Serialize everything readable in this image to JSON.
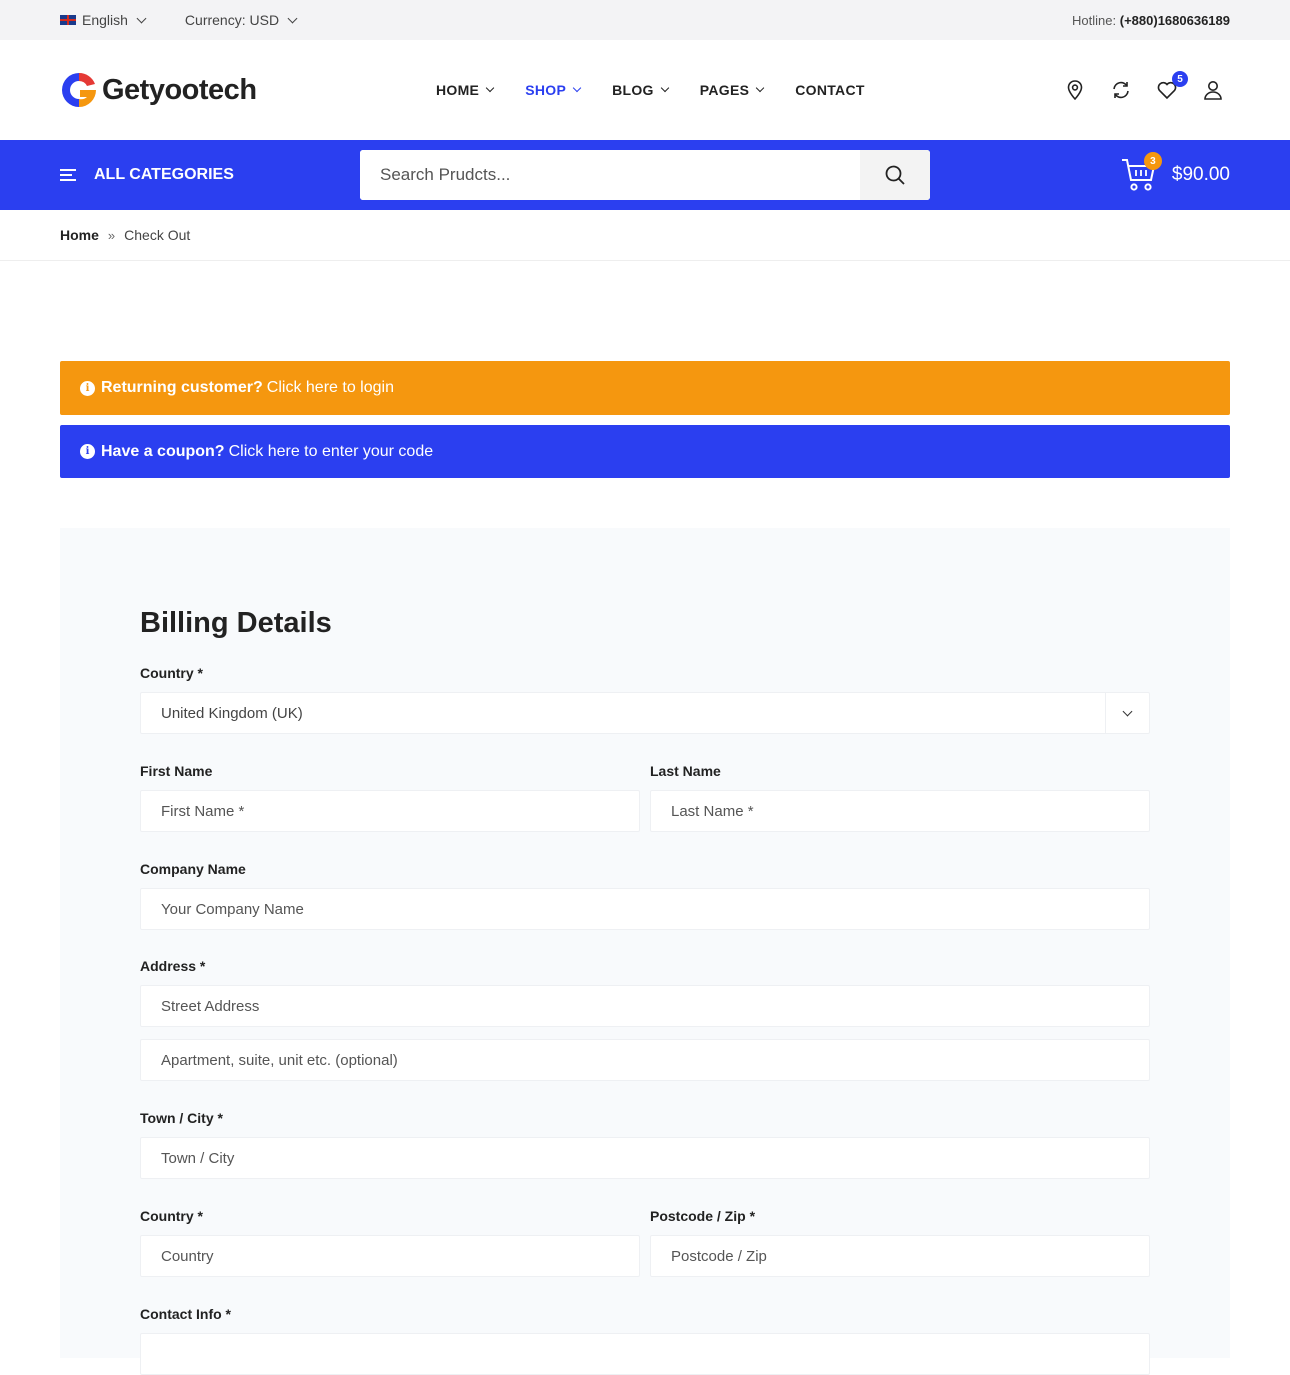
{
  "topbar": {
    "language": "English",
    "currency": "Currency: USD",
    "hotline_label": "Hotline:",
    "hotline_number": "(+880)1680636189"
  },
  "header": {
    "logo_text": "Getyootech",
    "nav": [
      {
        "label": "HOME",
        "active": false
      },
      {
        "label": "SHOP",
        "active": true
      },
      {
        "label": "BLOG",
        "active": false
      },
      {
        "label": "PAGES",
        "active": false
      },
      {
        "label": "CONTACT",
        "active": false
      }
    ],
    "wishlist_count": "5",
    "icons": [
      "location-icon",
      "compare-icon",
      "heart-icon",
      "user-icon"
    ]
  },
  "bluebar": {
    "categories_label": "ALL CATEGORIES",
    "search_placeholder": "Search Prudcts...",
    "cart_count": "3",
    "cart_total": "$90.00"
  },
  "breadcrumb": {
    "home": "Home",
    "separator": "»",
    "current": "Check Out"
  },
  "notices": {
    "returning_bold": "Returning customer?",
    "returning_link": "Click here to login",
    "coupon_bold": "Have a coupon?",
    "coupon_link": "Click here to enter your code"
  },
  "billing": {
    "title": "Billing Details",
    "country_label": "Country *",
    "country_value": "United Kingdom (UK)",
    "first_name_label": "First Name",
    "first_name_placeholder": "First Name *",
    "last_name_label": "Last Name",
    "last_name_placeholder": "Last Name *",
    "company_label": "Company Name",
    "company_placeholder": "Your Company Name",
    "address_label": "Address *",
    "street_placeholder": "Street Address",
    "apartment_placeholder": "Apartment, suite, unit etc. (optional)",
    "town_label": "Town / City *",
    "town_placeholder": "Town / City",
    "country2_label": "Country *",
    "country2_placeholder": "Country",
    "postcode_label": "Postcode / Zip *",
    "postcode_placeholder": "Postcode / Zip",
    "contact_label": "Contact Info *"
  },
  "colors": {
    "primary_blue": "#2b3ff0",
    "accent_orange": "#f5970f",
    "panel_bg": "#f8fafc"
  }
}
